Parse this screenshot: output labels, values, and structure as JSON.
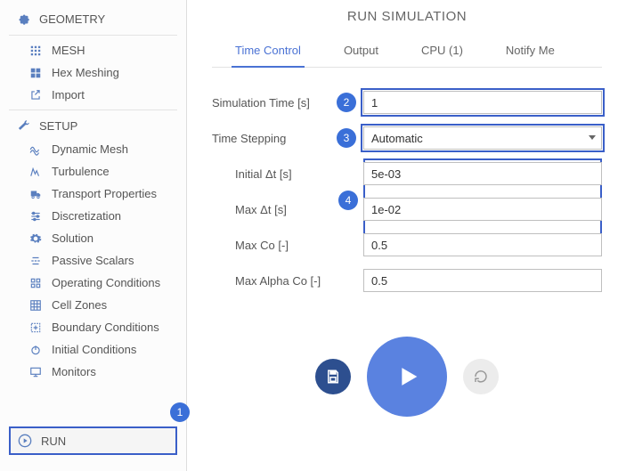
{
  "sidebar": {
    "geometry_header": "GEOMETRY",
    "mesh": "MESH",
    "hex_meshing": "Hex Meshing",
    "import": "Import",
    "setup_header": "SETUP",
    "dynamic_mesh": "Dynamic Mesh",
    "turbulence": "Turbulence",
    "transport": "Transport Properties",
    "discretization": "Discretization",
    "solution": "Solution",
    "passive_scalars": "Passive Scalars",
    "operating": "Operating Conditions",
    "cell_zones": "Cell Zones",
    "boundary": "Boundary Conditions",
    "initial": "Initial Conditions",
    "monitors": "Monitors",
    "run": "RUN"
  },
  "badges": {
    "b1": "1",
    "b2": "2",
    "b3": "3",
    "b4": "4"
  },
  "main": {
    "title": "RUN SIMULATION",
    "tabs": {
      "time_control": "Time Control",
      "output": "Output",
      "cpu": "CPU  (1)",
      "notify": "Notify Me"
    },
    "labels": {
      "sim_time": "Simulation Time [s]",
      "time_stepping": "Time Stepping",
      "initial_dt": "Initial Δt [s]",
      "max_dt": "Max Δt [s]",
      "max_co": "Max Co [-]",
      "max_alpha_co": "Max Alpha Co [-]"
    },
    "values": {
      "sim_time": "1",
      "time_stepping": "Automatic",
      "initial_dt": "5e-03",
      "max_dt": "1e-02",
      "max_co": "0.5",
      "max_alpha_co": "0.5"
    }
  }
}
